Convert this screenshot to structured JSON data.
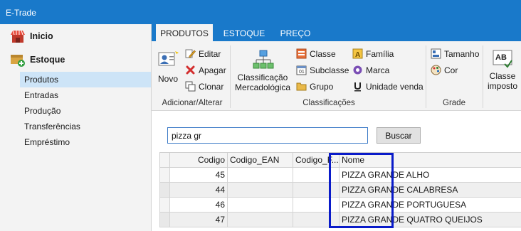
{
  "app": {
    "title": "E-Trade"
  },
  "sidebar": {
    "sections": [
      {
        "label": "Inicio"
      },
      {
        "label": "Estoque"
      }
    ],
    "items": [
      {
        "label": "Produtos"
      },
      {
        "label": "Entradas"
      },
      {
        "label": "Produção"
      },
      {
        "label": "Transferências"
      },
      {
        "label": "Empréstimo"
      }
    ],
    "active_item": "Produtos"
  },
  "tabs": [
    {
      "label": "PRODUTOS"
    },
    {
      "label": "ESTOQUE"
    },
    {
      "label": "PREÇO"
    }
  ],
  "active_tab": "PRODUTOS",
  "ribbon": {
    "groups": [
      {
        "label": "Adicionar/Alterar"
      },
      {
        "label": "Classificações"
      },
      {
        "label": "Grade"
      }
    ],
    "novo": "Novo",
    "editar": "Editar",
    "apagar": "Apagar",
    "clonar": "Clonar",
    "classificacao_line1": "Classificação",
    "classificacao_line2": "Mercadológica",
    "classe": "Classe",
    "subclasse": "Subclasse",
    "grupo": "Grupo",
    "familia": "Família",
    "marca": "Marca",
    "unidade_venda": "Unidade venda",
    "tamanho": "Tamanho",
    "cor": "Cor",
    "classe_imposto_line1": "Classe",
    "classe_imposto_line2": "imposto",
    "ab_icon_text": "AB"
  },
  "search": {
    "value": "pizza gr",
    "button": "Buscar"
  },
  "table": {
    "columns": [
      "Codigo",
      "Codigo_EAN",
      "Codigo_F...",
      "Nome"
    ],
    "rows": [
      {
        "codigo": "45",
        "ean": "",
        "codf": "",
        "nome": "PIZZA GRANDE ALHO"
      },
      {
        "codigo": "44",
        "ean": "",
        "codf": "",
        "nome": "PIZZA GRANDE CALABRESA"
      },
      {
        "codigo": "46",
        "ean": "",
        "codf": "",
        "nome": "PIZZA GRANDE PORTUGUESA"
      },
      {
        "codigo": "47",
        "ean": "",
        "codf": "",
        "nome": "PIZZA GRANDE QUATRO QUEIJOS"
      }
    ]
  },
  "colors": {
    "titlebar": "#1979ca",
    "active_sidebar": "#cde4f7",
    "highlight_box": "#0a1bc9"
  }
}
